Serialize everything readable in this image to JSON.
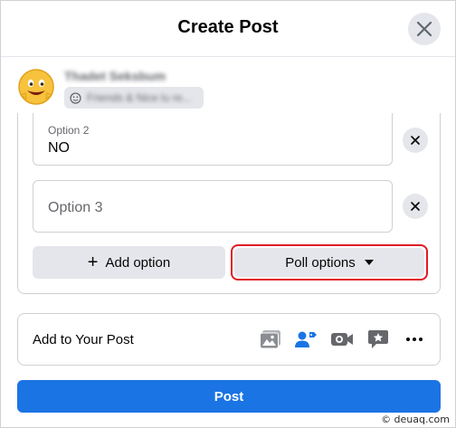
{
  "dialog": {
    "title": "Create Post",
    "close_icon": "close-icon"
  },
  "user": {
    "name": "Thadet Seksbum",
    "audience": "Friends & Nice lu re...",
    "audience_icon": "emoji-icon"
  },
  "poll": {
    "options": [
      {
        "label": "Option 2",
        "value": "NO"
      },
      {
        "label": "",
        "placeholder": "Option 3",
        "value": ""
      }
    ],
    "add_option_label": "Add option",
    "poll_options_label": "Poll options"
  },
  "add_to_post": {
    "label": "Add to Your Post",
    "tools": [
      "photo-video-icon",
      "tag-people-icon",
      "live-video-icon",
      "feeling-activity-icon",
      "more-icon"
    ]
  },
  "post_button": {
    "label": "Post"
  },
  "watermark": "© deuaq.com",
  "colors": {
    "accent": "#1b74e4",
    "highlight_border": "#e01b24",
    "button_gray": "#e4e6eb",
    "photo_icon": "#8a8d91",
    "tag_icon": "#1b74e4",
    "live_icon": "#65676b"
  }
}
